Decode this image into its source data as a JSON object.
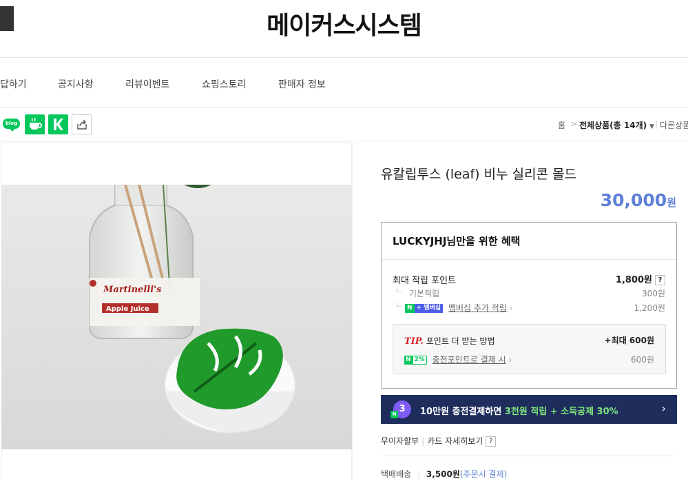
{
  "header": {
    "store_name": "메이커스시스템"
  },
  "nav": {
    "items": [
      "답하기",
      "공지사항",
      "리뷰이벤트",
      "쇼핑스토리",
      "판매자 정보"
    ]
  },
  "social": {
    "blog_label": "blog"
  },
  "breadcrumb": {
    "home": "홈",
    "sep": ">",
    "category_prefix": "전체상품",
    "count": "(총 14개)",
    "other": "다른상품보"
  },
  "product": {
    "title": "유칼립투스 (leaf) 비누 실리콘 몰드",
    "price": "30,000",
    "price_unit": "원",
    "photo_labels": {
      "brand": "Martinelli's",
      "juice": "Apple Juice"
    }
  },
  "benefit": {
    "heading": "LUCKYJHJ님만을 위한 혜택",
    "max_points_label": "최대 적립 포인트",
    "max_points_value": "1,800원",
    "basic_label": "기본적립",
    "basic_value": "300원",
    "membership_badge": "멤버십",
    "membership_label": "멤버십 추가 적립",
    "membership_value": "1,200원",
    "tip_prefix": "TIP.",
    "tip_text": "포인트 더 받는 방법",
    "tip_max": "+최대 600원",
    "charge_badge": "2%",
    "charge_label": "충전포인트로 결제 시",
    "charge_value": "600원"
  },
  "promo": {
    "badge": "3",
    "text_a": "10만원 충전결제하면 ",
    "text_b": "3천원 적립 + 소득공제 30%"
  },
  "payment": {
    "installment": "무이자할부",
    "card_details": "카드 자세히보기"
  },
  "shipping": {
    "label": "택배배송",
    "fee": "3,500원",
    "note": "(주문시 결제)"
  },
  "colors": {
    "accent": "#5d80d6",
    "naver_green": "#03c75a",
    "promo_bg": "#1e2d5c"
  }
}
